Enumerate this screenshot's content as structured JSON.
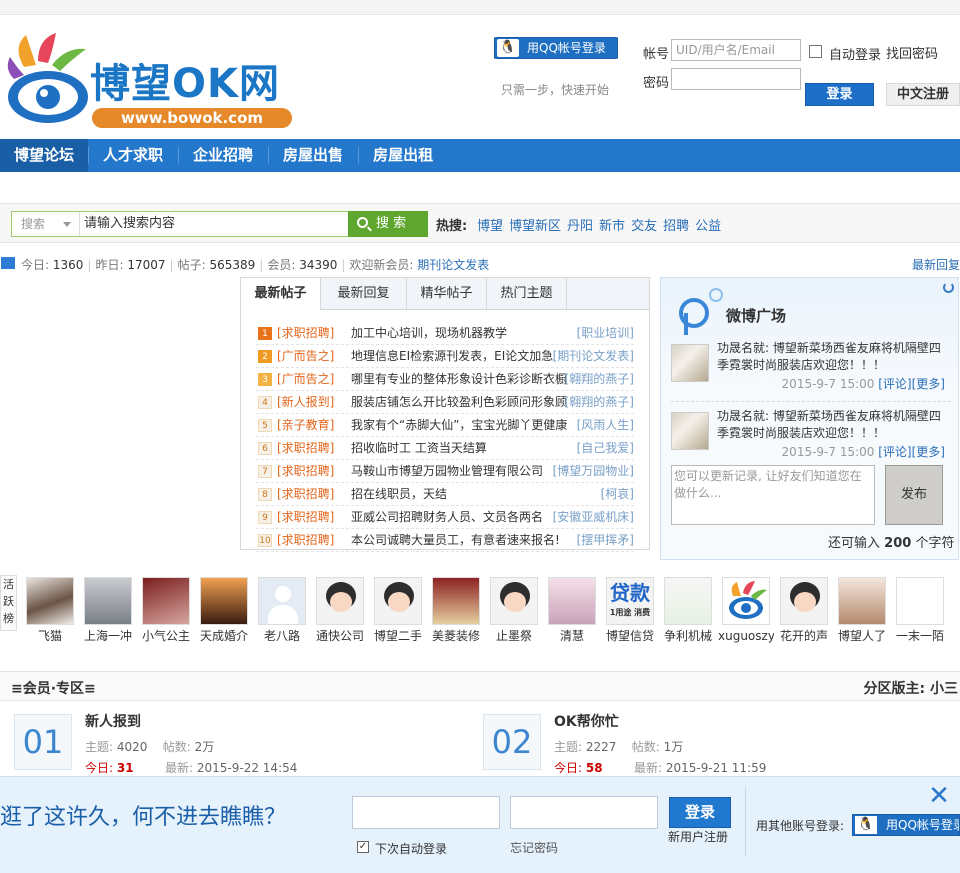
{
  "header": {
    "logo_text": "博望OK网",
    "logo_url": "www.bowok.com",
    "qq_login_label": "用QQ帐号登录",
    "qq_login_sub": "只需一步，快速开始",
    "account_label": "帐号",
    "account_placeholder": "UID/用户名/Email",
    "password_label": "密码",
    "auto_login_label": "自动登录",
    "forgot_password": "找回密码",
    "login_button": "登录",
    "register_button": "中文注册"
  },
  "nav": {
    "items": [
      {
        "label": "博望论坛",
        "active": true
      },
      {
        "label": "人才求职"
      },
      {
        "label": "企业招聘"
      },
      {
        "label": "房屋出售"
      },
      {
        "label": "房屋出租"
      }
    ]
  },
  "search": {
    "type_label": "搜索",
    "input_value": "请输入搜索内容",
    "button_label": "搜 索",
    "hot_label": "热搜:",
    "hot_terms": [
      "博望",
      "博望新区",
      "丹阳",
      "新市",
      "交友",
      "招聘",
      "公益"
    ]
  },
  "stats": {
    "today_label": "今日:",
    "today": "1360",
    "yesterday_label": "昨日:",
    "yesterday": "17007",
    "posts_label": "帖子:",
    "posts": "565389",
    "members_label": "会员:",
    "members": "34390",
    "new_member_label": "欢迎新会员:",
    "new_member": "期刊论文发表",
    "latest_reply_link": "最新回复"
  },
  "posts_panel": {
    "tabs": [
      "最新帖子",
      "最新回复",
      "精华帖子",
      "热门主题"
    ],
    "rows": [
      {
        "num": "1",
        "cat": "[求职招聘]",
        "title": "加工中心培训，现场机器教学",
        "author": "[职业培训]"
      },
      {
        "num": "2",
        "cat": "[广而告之]",
        "title": "地理信息EI检索源刊发表，EI论文加急",
        "author": "[期刊论文发表]"
      },
      {
        "num": "3",
        "cat": "[广而告之]",
        "title": "哪里有专业的整体形象设计色彩诊断衣橱",
        "author": "[翱翔的燕子]"
      },
      {
        "num": "4",
        "cat": "[新人报到]",
        "title": "服装店铺怎么开比较盈利色彩顾问形象顾",
        "author": "[翱翔的燕子]"
      },
      {
        "num": "5",
        "cat": "[亲子教育]",
        "title": "我家有个“赤脚大仙”，宝宝光脚丫更健康",
        "author": "[风雨人生]"
      },
      {
        "num": "6",
        "cat": "[求职招聘]",
        "title": "招收临时工 工资当天结算",
        "author": "[自己我爱]"
      },
      {
        "num": "7",
        "cat": "[求职招聘]",
        "title": "马鞍山市博望万园物业管理有限公司",
        "author": "[博望万园物业]"
      },
      {
        "num": "8",
        "cat": "[求职招聘]",
        "title": "招在线职员，天结",
        "author": "[柯哀]"
      },
      {
        "num": "9",
        "cat": "[求职招聘]",
        "title": "亚威公司招聘财务人员、文员各两名",
        "author": "[安徽亚威机床]"
      },
      {
        "num": "10",
        "cat": "[求职招聘]",
        "title": "本公司诚聘大量员工，有意者速来报名!",
        "author": "[摆甲挥矛]"
      }
    ]
  },
  "weibo": {
    "title": "微博广场",
    "feeds": [
      {
        "text": "功晟名就: 博望新菜场西雀友麻将机隔壁四季霓裳时尚服装店欢迎您！！！",
        "time": "2015-9-7 15:00",
        "comment": "[评论]",
        "more": "[更多]"
      },
      {
        "text": "功晟名就: 博望新菜场西雀友麻将机隔壁四季霓裳时尚服装店欢迎您！！！",
        "time": "2015-9-7 15:00",
        "comment": "[评论]",
        "more": "[更多]"
      }
    ],
    "textarea_placeholder": "您可以更新记录, 让好友们知道您在做什么...",
    "publish_button": "发布",
    "count_prefix": "还可输入",
    "count_value": "200",
    "count_suffix": "个字符"
  },
  "active_users": {
    "label": "活跃榜",
    "users": [
      {
        "name": "飞猫",
        "avatar": "photo"
      },
      {
        "name": "上海一冲",
        "avatar": "photo"
      },
      {
        "name": "小气公主",
        "avatar": "photo"
      },
      {
        "name": "天成婚介",
        "avatar": "photo"
      },
      {
        "name": "老八路",
        "avatar": "default"
      },
      {
        "name": "通快公司",
        "avatar": "cartoon"
      },
      {
        "name": "博望二手",
        "avatar": "cartoon"
      },
      {
        "name": "美菱装修",
        "avatar": "photo"
      },
      {
        "name": "止墨祭",
        "avatar": "cartoon"
      },
      {
        "name": "清慧",
        "avatar": "photo"
      },
      {
        "name": "博望信贷",
        "avatar": "text",
        "avatar_text": "贷款"
      },
      {
        "name": "争利机械",
        "avatar": "photo"
      },
      {
        "name": "xuguoszy",
        "avatar": "logo"
      },
      {
        "name": "花开的声",
        "avatar": "cartoon"
      },
      {
        "name": "博望人了",
        "avatar": "photo"
      },
      {
        "name": "一末一陌",
        "avatar": "photo"
      }
    ]
  },
  "member_section": {
    "title": "≡会员·专区≡",
    "moderator": "分区版主: 小三",
    "forums": [
      {
        "badge": "01",
        "name": "新人报到",
        "topics_label": "主题:",
        "topics": "4020",
        "posts_label": "帖数:",
        "posts": "2万",
        "today_label": "今日:",
        "today": "31",
        "latest_label": "最新:",
        "latest": "2015-9-22 14:54"
      },
      {
        "badge": "02",
        "name": "OK帮你忙",
        "topics_label": "主题:",
        "topics": "2227",
        "posts_label": "帖数:",
        "posts": "1万",
        "today_label": "今日:",
        "today": "58",
        "latest_label": "最新:",
        "latest": "2015-9-21 11:59"
      }
    ]
  },
  "bottom_bar": {
    "slogan": "逛了这许久，何不进去瞧瞧？",
    "auto_login": "下次自动登录",
    "forgot": "忘记密码",
    "login_button": "登录",
    "register": "新用户注册",
    "other_login": "用其他账号登录:",
    "qq_login": "用QQ帐号登录",
    "close": "✕"
  },
  "colors": {
    "brand_blue": "#2478cb",
    "nav_active": "#1a5fa6",
    "category_orange": "#e2651b",
    "search_green": "#5fa62e"
  }
}
